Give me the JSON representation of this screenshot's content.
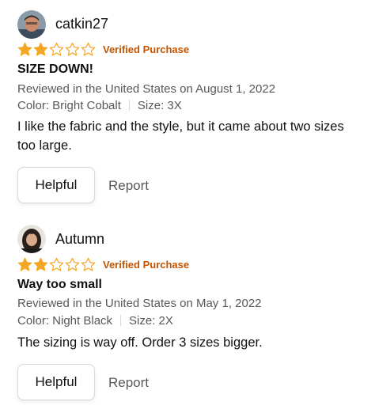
{
  "colors": {
    "star_fill": "#f5a623",
    "verified": "#c45500",
    "meta_text": "#565959",
    "primary_text": "#0f1111",
    "button_border": "#d5d9d9"
  },
  "reviews": [
    {
      "username": "catkin27",
      "rating": 2,
      "max_rating": 5,
      "verified_label": "Verified Purchase",
      "title": "SIZE DOWN!",
      "date_line": "Reviewed in the United States on August 1, 2022",
      "color_label": "Color: Bright Cobalt",
      "size_label": "Size: 3X",
      "body": "I like the fabric and the style, but it came about two sizes too large.",
      "helpful_label": "Helpful",
      "report_label": "Report"
    },
    {
      "username": "Autumn",
      "rating": 2,
      "max_rating": 5,
      "verified_label": "Verified Purchase",
      "title": "Way too small",
      "date_line": "Reviewed in the United States on May 1, 2022",
      "color_label": "Color: Night Black",
      "size_label": "Size: 2X",
      "body": "The sizing is way off. Order 3 sizes bigger.",
      "helpful_label": "Helpful",
      "report_label": "Report"
    }
  ]
}
